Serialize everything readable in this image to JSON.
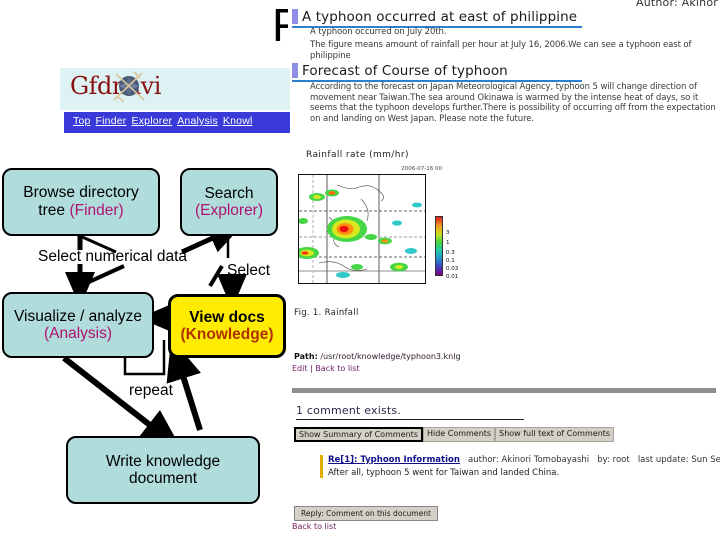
{
  "slide": {
    "title_letter": "F",
    "accent_cyan": "#b0dcdc",
    "accent_yellow": "#ffec00",
    "accent_magenta": "#b01070",
    "accent_brown": "#b03000"
  },
  "flow": {
    "boxes": [
      {
        "id": "finder",
        "line1": "Browse directory",
        "line1b": "tree",
        "line2": "(Finder)"
      },
      {
        "id": "explorer",
        "line1": "Search",
        "line2": "(Explorer)"
      },
      {
        "id": "analysis",
        "line1": "Visualize / analyze",
        "line2": "(Analysis)"
      },
      {
        "id": "knowledge",
        "line1": "View docs",
        "line2": "(Knowledge)"
      },
      {
        "id": "write",
        "line1": "Write knowledge",
        "line2": "document"
      }
    ],
    "labels": {
      "select_numerical": "Select numerical data",
      "select": "Select",
      "repeat": "repeat"
    }
  },
  "site": {
    "logo_text": "Gfdnavi",
    "nav_items": [
      "Top",
      "Finder",
      "Explorer",
      "Analysis",
      "Knowl"
    ]
  },
  "doc": {
    "author_line": "Author: Akinor",
    "heading_1": "A typhoon occurred at east of philippine",
    "para_1": "A typhoon occurred on July 20th.",
    "para_2": "The figure means amount of rainfall per hour at July 16, 2006.We can see a typhoon east of philippine",
    "heading_2": "Forecast of Course of typhoon",
    "para_3": "According to the forecast on Japan Meteorological Agency, typhoon 5 will change direction of movement near Taiwan.The sea around Okinawa is warmed by the intense heat of days, so it seems that the typhoon develops further.There is possibility of occurring off from the expectation on and landing on West Japan. Please note the future.",
    "figure": {
      "title": "Rainfall rate (mm/hr)",
      "timestamp": "2006-07-16 00",
      "caption": "Fig. 1.  Rainfall",
      "colorbar_ticks": [
        "3",
        "1",
        "0.3",
        "0.1",
        "0.03",
        "0.01"
      ]
    },
    "path_label": "Path:",
    "path_value": "/usr/root/knowledge/typhoon3.knlg",
    "edit_link": "Edit",
    "back_link": "Back to list",
    "comment_count": "1 comment exists.",
    "comment_buttons": [
      "Show Summary of Comments",
      "Hide Comments",
      "Show full text of Comments"
    ],
    "comment": {
      "subject": "Re[1]: Typhoon Information",
      "author_label": "author:",
      "author": "Akinori Tomobayashi",
      "by": "by: root",
      "updated": "last update: Sun Sep",
      "body": "After all, typhoon 5 went for Taiwan and landed China."
    },
    "reply_button": "Reply: Comment on this document",
    "back_to_list": "Back to list"
  }
}
